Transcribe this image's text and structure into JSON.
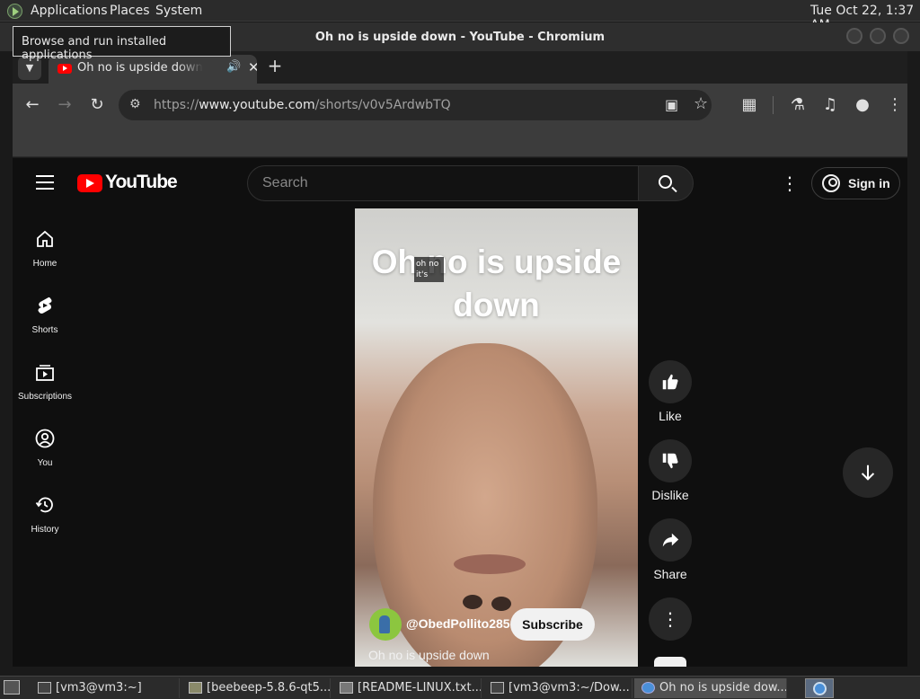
{
  "system_panel": {
    "menus": [
      "Applications",
      "Places",
      "System"
    ],
    "clock": "Tue Oct 22,  1:37 AM"
  },
  "tooltip": "Browse and run installed applications",
  "window": {
    "title": "Oh no is upside down - YouTube - Chromium"
  },
  "tab": {
    "title": "Oh no is upside down - YouTube"
  },
  "omnibox": {
    "scheme": "https://",
    "host": "www.youtube.com",
    "path": "/shorts/v0v5ArdwbTQ"
  },
  "youtube": {
    "wordmark": "YouTube",
    "search_placeholder": "Search",
    "sign_in": "Sign in",
    "sidebar": [
      {
        "label": "Home",
        "icon": "home-icon"
      },
      {
        "label": "Shorts",
        "icon": "shorts-icon"
      },
      {
        "label": "Subscriptions",
        "icon": "subscriptions-icon"
      },
      {
        "label": "You",
        "icon": "you-icon"
      },
      {
        "label": "History",
        "icon": "history-icon"
      }
    ],
    "video": {
      "caption": "Oh no is upside down",
      "small_caption": "oh no it's",
      "channel": "@ObedPollito285",
      "subscribe": "Subscribe",
      "title": "Oh no is upside down"
    },
    "actions": {
      "like": "Like",
      "dislike": "Dislike",
      "share": "Share"
    }
  },
  "taskbar": [
    {
      "label": "[vm3@vm3:~]",
      "icon": "terminal-icon"
    },
    {
      "label": "[beebeep-5.8.6-qt5...",
      "icon": "folder-icon"
    },
    {
      "label": "[README-LINUX.txt...",
      "icon": "text-file-icon"
    },
    {
      "label": "[vm3@vm3:~/Dow...",
      "icon": "terminal-icon"
    },
    {
      "label": "Oh no is upside dow...",
      "icon": "chromium-icon"
    }
  ]
}
